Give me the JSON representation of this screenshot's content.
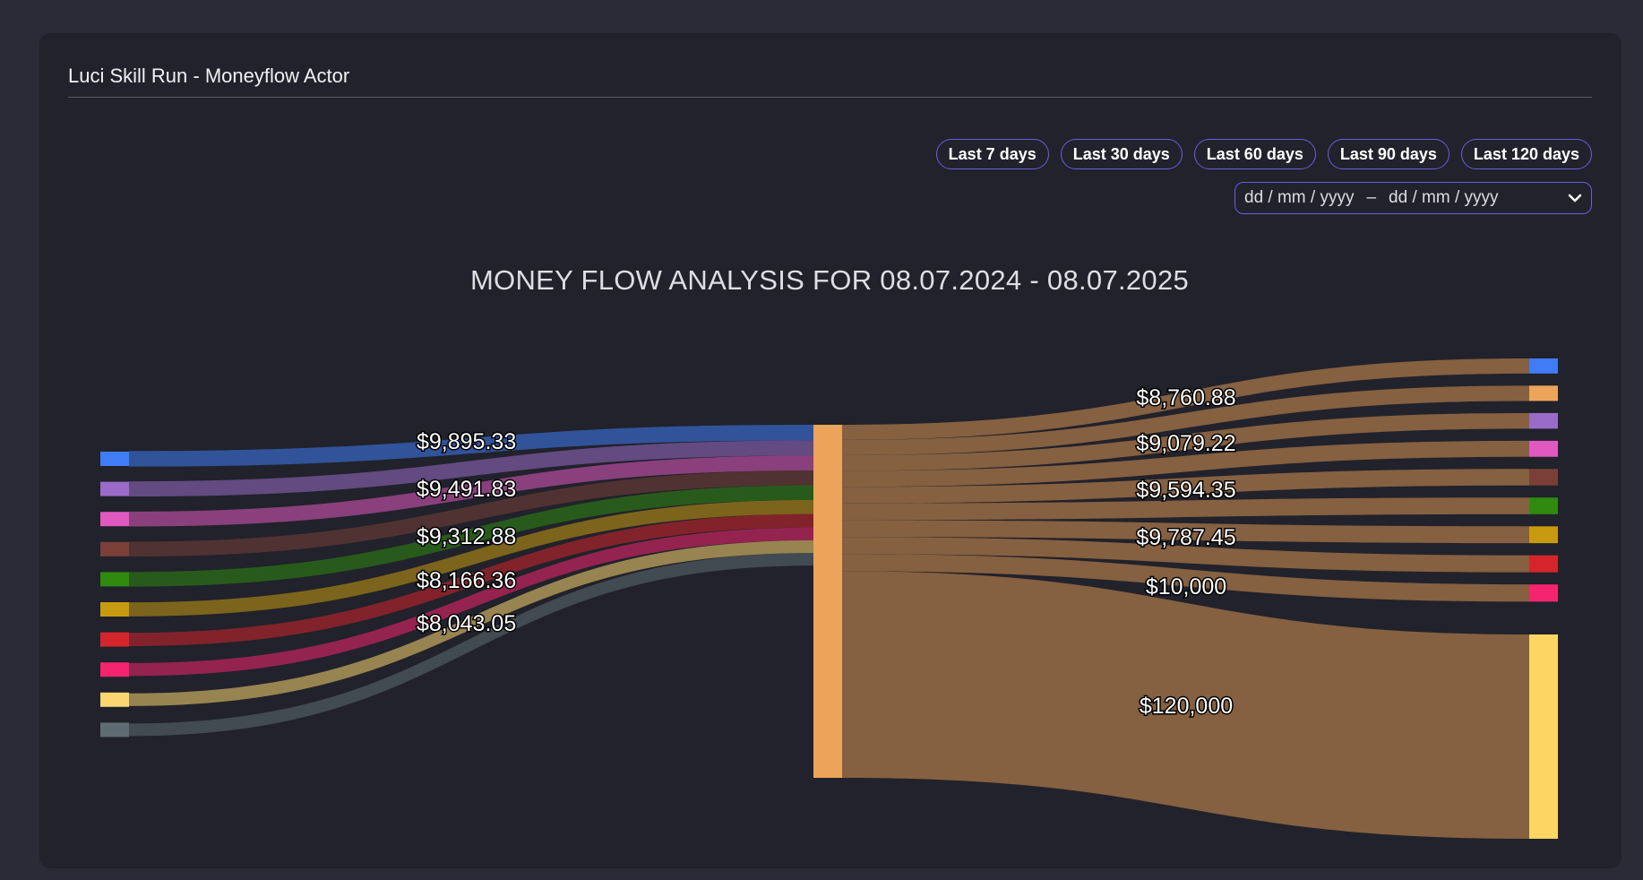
{
  "card": {
    "title": "Luci Skill Run - Moneyflow Actor"
  },
  "range_buttons": [
    "Last 7 days",
    "Last 30 days",
    "Last 60 days",
    "Last 90 days",
    "Last 120 days"
  ],
  "date_range": {
    "start_placeholder": "dd / mm / yyyy",
    "separator": "–",
    "end_placeholder": "dd / mm / yyyy",
    "icon": "chevron-down-icon"
  },
  "chart_data": {
    "type": "sankey",
    "title": "MONEY FLOW ANALYSIS FOR 08.07.2024 - 08.07.2025",
    "center_node_color": "#eba459",
    "inflows": [
      {
        "value": 9895.33,
        "label": "$9,895.33",
        "color": "#3f7cf5"
      },
      {
        "value": 9600,
        "label": "",
        "color": "#9a6bc9"
      },
      {
        "value": 9491.83,
        "label": "$9,491.83",
        "color": "#e059c0"
      },
      {
        "value": 9400,
        "label": "",
        "color": "#7a4038"
      },
      {
        "value": 9312.88,
        "label": "$9,312.88",
        "color": "#2f8a0f"
      },
      {
        "value": 8900,
        "label": "",
        "color": "#c89a10"
      },
      {
        "value": 8500,
        "label": "",
        "color": "#d4252c"
      },
      {
        "value": 8166.36,
        "label": "$8,166.36",
        "color": "#f5246f"
      },
      {
        "value": 8043.05,
        "label": "$8,043.05",
        "color": "#fcd671"
      },
      {
        "value": 8000,
        "label": "",
        "color": "#5f6b72"
      }
    ],
    "outflows": [
      {
        "value": 8760.88,
        "label": "$8,760.88",
        "color": "#3f7cf5"
      },
      {
        "value": 8900,
        "label": "",
        "color": "#eba459"
      },
      {
        "value": 9079.22,
        "label": "$9,079.22",
        "color": "#9a6bc9"
      },
      {
        "value": 9300,
        "label": "",
        "color": "#e059c0"
      },
      {
        "value": 9594.35,
        "label": "$9,594.35",
        "color": "#7a4038"
      },
      {
        "value": 9700,
        "label": "",
        "color": "#2f8a0f"
      },
      {
        "value": 9787.45,
        "label": "$9,787.45",
        "color": "#c89a10"
      },
      {
        "value": 9900,
        "label": "",
        "color": "#d4252c"
      },
      {
        "value": 10000,
        "label": "$10,000",
        "color": "#f5246f"
      },
      {
        "value": 120000,
        "label": "$120,000",
        "color": "#fdd562"
      }
    ],
    "outflow_link_color": "#8b6442"
  }
}
